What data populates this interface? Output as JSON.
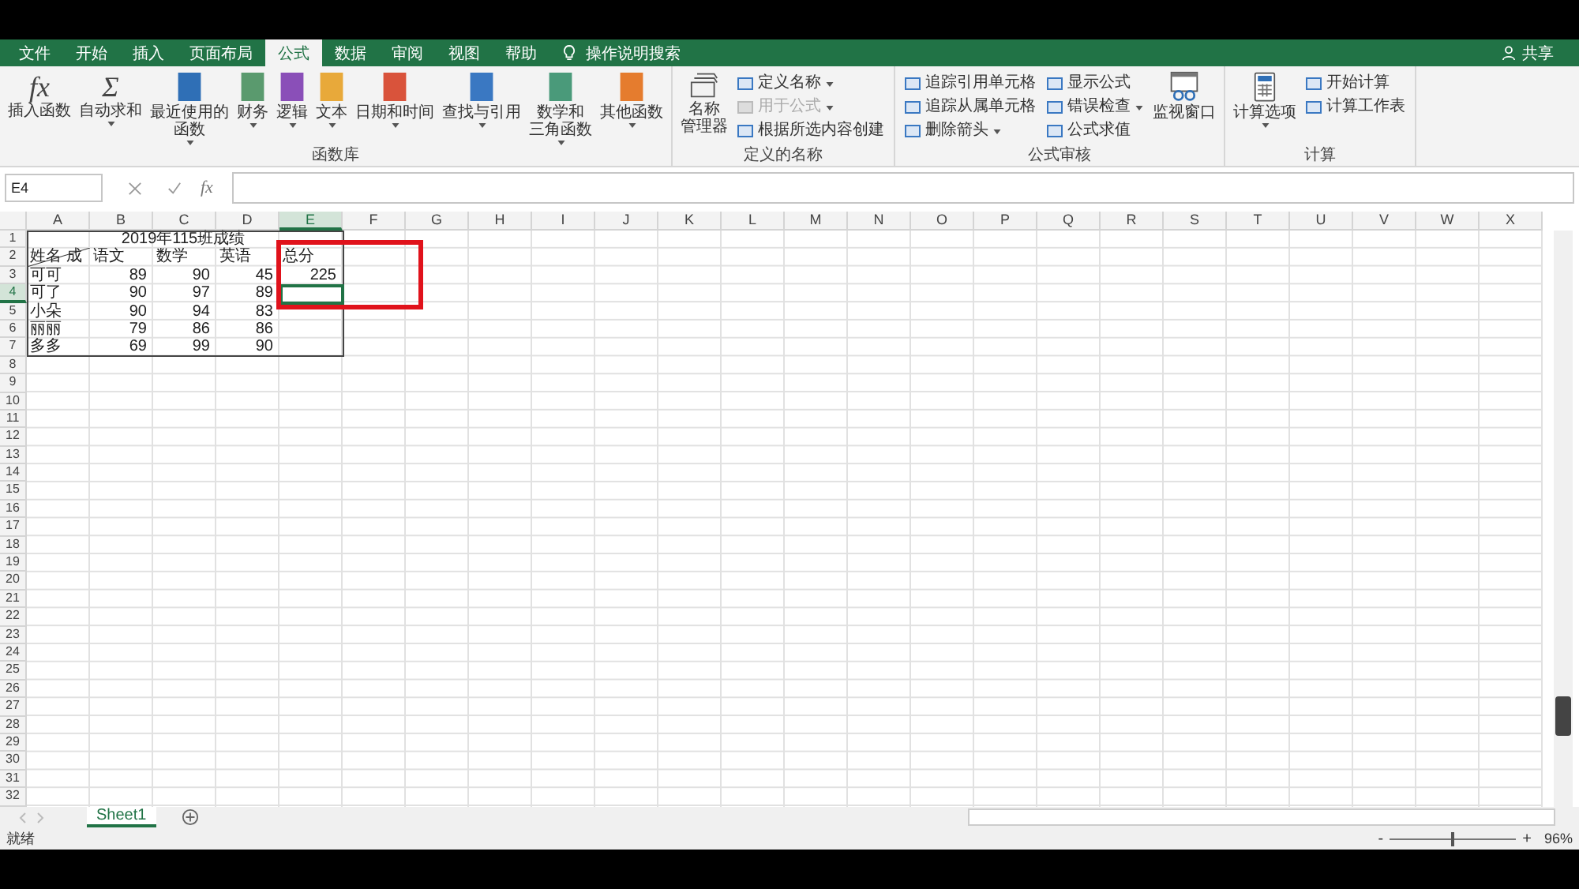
{
  "tabs": [
    {
      "label": "文件",
      "selected": false
    },
    {
      "label": "开始",
      "selected": false
    },
    {
      "label": "插入",
      "selected": false
    },
    {
      "label": "页面布局",
      "selected": false
    },
    {
      "label": "公式",
      "selected": true
    },
    {
      "label": "数据",
      "selected": false
    },
    {
      "label": "审阅",
      "selected": false
    },
    {
      "label": "视图",
      "selected": false
    },
    {
      "label": "帮助",
      "selected": false
    }
  ],
  "search": {
    "label": "操作说明搜索"
  },
  "share": {
    "label": "共享"
  },
  "ribbon": [
    {
      "title": "函数库",
      "items": [
        {
          "kind": "glyph",
          "glyph": "fx",
          "lines": [
            "插入函数"
          ],
          "has_menu": false
        },
        {
          "kind": "glyph",
          "glyph": "Σ",
          "lines": [
            "自动求和"
          ],
          "has_menu": true
        },
        {
          "kind": "book",
          "color": "#2f6fb6",
          "lines": [
            "最近使用的",
            "函数"
          ],
          "has_menu": true
        },
        {
          "kind": "book",
          "color": "#5a9a6e",
          "lines": [
            "财务"
          ],
          "has_menu": true
        },
        {
          "kind": "book",
          "color": "#8a4fb8",
          "lines": [
            "逻辑"
          ],
          "has_menu": true
        },
        {
          "kind": "book",
          "color": "#e8a93a",
          "lines": [
            "文本"
          ],
          "has_menu": true
        },
        {
          "kind": "book",
          "color": "#d9533b",
          "lines": [
            "日期和时间"
          ],
          "has_menu": true
        },
        {
          "kind": "book",
          "color": "#3a78c2",
          "lines": [
            "查找与引用"
          ],
          "has_menu": true
        },
        {
          "kind": "book",
          "color": "#4a9a7a",
          "lines": [
            "数学和",
            "三角函数"
          ],
          "has_menu": true
        },
        {
          "kind": "book",
          "color": "#e57c2e",
          "lines": [
            "其他函数"
          ],
          "has_menu": true
        }
      ]
    },
    {
      "title": "定义的名称",
      "items": [
        {
          "kind": "cards",
          "lines": [
            "名称",
            "管理器"
          ],
          "has_menu": false
        },
        {
          "kind": "small",
          "lines": [
            "定义名称"
          ],
          "has_menu": true,
          "disabled": false
        },
        {
          "kind": "small",
          "lines": [
            "用于公式"
          ],
          "has_menu": true,
          "disabled": true
        },
        {
          "kind": "small",
          "lines": [
            "根据所选内容创建"
          ],
          "has_menu": false,
          "disabled": false
        }
      ]
    },
    {
      "title": "公式审核",
      "items": [
        {
          "kind": "small",
          "lines": [
            "追踪引用单元格"
          ],
          "has_menu": false,
          "disabled": false
        },
        {
          "kind": "small",
          "lines": [
            "追踪从属单元格"
          ],
          "has_menu": false,
          "disabled": false
        },
        {
          "kind": "small",
          "lines": [
            "删除箭头"
          ],
          "has_menu": true,
          "disabled": false
        },
        {
          "kind": "small",
          "lines": [
            "显示公式"
          ],
          "has_menu": false,
          "disabled": false
        },
        {
          "kind": "small",
          "lines": [
            "错误检查"
          ],
          "has_menu": true,
          "disabled": false
        },
        {
          "kind": "small",
          "lines": [
            "公式求值"
          ],
          "has_menu": false,
          "disabled": false
        },
        {
          "kind": "window",
          "lines": [
            "监视窗口"
          ],
          "has_menu": false
        }
      ]
    },
    {
      "title": "计算",
      "items": [
        {
          "kind": "calculator",
          "lines": [
            "计算选项"
          ],
          "has_menu": true
        },
        {
          "kind": "small",
          "lines": [
            "开始计算"
          ],
          "has_menu": false,
          "disabled": false
        },
        {
          "kind": "small",
          "lines": [
            "计算工作表"
          ],
          "has_menu": false,
          "disabled": false
        }
      ]
    }
  ],
  "formula_bar": {
    "name_box": "E4",
    "function_symbol": "fx"
  },
  "sheet": {
    "columns": [
      {
        "label": "A",
        "selected": false
      },
      {
        "label": "B",
        "selected": false
      },
      {
        "label": "C",
        "selected": false
      },
      {
        "label": "D",
        "selected": false
      },
      {
        "label": "E",
        "selected": true
      },
      {
        "label": "F",
        "selected": false
      },
      {
        "label": "G",
        "selected": false
      },
      {
        "label": "H",
        "selected": false
      },
      {
        "label": "I",
        "selected": false
      },
      {
        "label": "J",
        "selected": false
      },
      {
        "label": "K",
        "selected": false
      },
      {
        "label": "L",
        "selected": false
      },
      {
        "label": "M",
        "selected": false
      },
      {
        "label": "N",
        "selected": false
      },
      {
        "label": "O",
        "selected": false
      },
      {
        "label": "P",
        "selected": false
      },
      {
        "label": "Q",
        "selected": false
      },
      {
        "label": "R",
        "selected": false
      },
      {
        "label": "S",
        "selected": false
      },
      {
        "label": "T",
        "selected": false
      },
      {
        "label": "U",
        "selected": false
      },
      {
        "label": "V",
        "selected": false
      },
      {
        "label": "W",
        "selected": false
      },
      {
        "label": "X",
        "selected": false
      }
    ],
    "rows": [
      {
        "label": "1",
        "selected": false
      },
      {
        "label": "2",
        "selected": false
      },
      {
        "label": "3",
        "selected": false
      },
      {
        "label": "4",
        "selected": true
      },
      {
        "label": "5",
        "selected": false
      },
      {
        "label": "6",
        "selected": false
      },
      {
        "label": "7",
        "selected": false
      },
      {
        "label": "8",
        "selected": false
      },
      {
        "label": "9",
        "selected": false
      },
      {
        "label": "10",
        "selected": false
      },
      {
        "label": "11",
        "selected": false
      },
      {
        "label": "12",
        "selected": false
      },
      {
        "label": "13",
        "selected": false
      },
      {
        "label": "14",
        "selected": false
      },
      {
        "label": "15",
        "selected": false
      },
      {
        "label": "16",
        "selected": false
      },
      {
        "label": "17",
        "selected": false
      },
      {
        "label": "18",
        "selected": false
      },
      {
        "label": "19",
        "selected": false
      },
      {
        "label": "20",
        "selected": false
      },
      {
        "label": "21",
        "selected": false
      },
      {
        "label": "22",
        "selected": false
      },
      {
        "label": "23",
        "selected": false
      },
      {
        "label": "24",
        "selected": false
      },
      {
        "label": "25",
        "selected": false
      },
      {
        "label": "26",
        "selected": false
      },
      {
        "label": "27",
        "selected": false
      },
      {
        "label": "28",
        "selected": false
      },
      {
        "label": "29",
        "selected": false
      },
      {
        "label": "30",
        "selected": false
      },
      {
        "label": "31",
        "selected": false
      },
      {
        "label": "32",
        "selected": false
      }
    ],
    "title": "2019年115班成绩",
    "header": [
      "姓名 成",
      "语文",
      "数学",
      "英语",
      "总分"
    ],
    "records": [
      {
        "cells": [
          "可可",
          "89",
          "90",
          "45",
          "225"
        ]
      },
      {
        "cells": [
          "可了",
          "90",
          "97",
          "89"
        ]
      },
      {
        "cells": [
          "小朵",
          "90",
          "94",
          "83"
        ]
      },
      {
        "cells": [
          "丽丽",
          "79",
          "86",
          "86"
        ]
      },
      {
        "cells": [
          "多多",
          "69",
          "99",
          "90"
        ]
      }
    ]
  },
  "sheet_tabs": [
    {
      "label": "Sheet1",
      "selected": true
    }
  ],
  "status_bar": {
    "status": "就绪",
    "zoom": "96%",
    "zoom_out": "-",
    "zoom_in": "+",
    "level": 0.48
  }
}
